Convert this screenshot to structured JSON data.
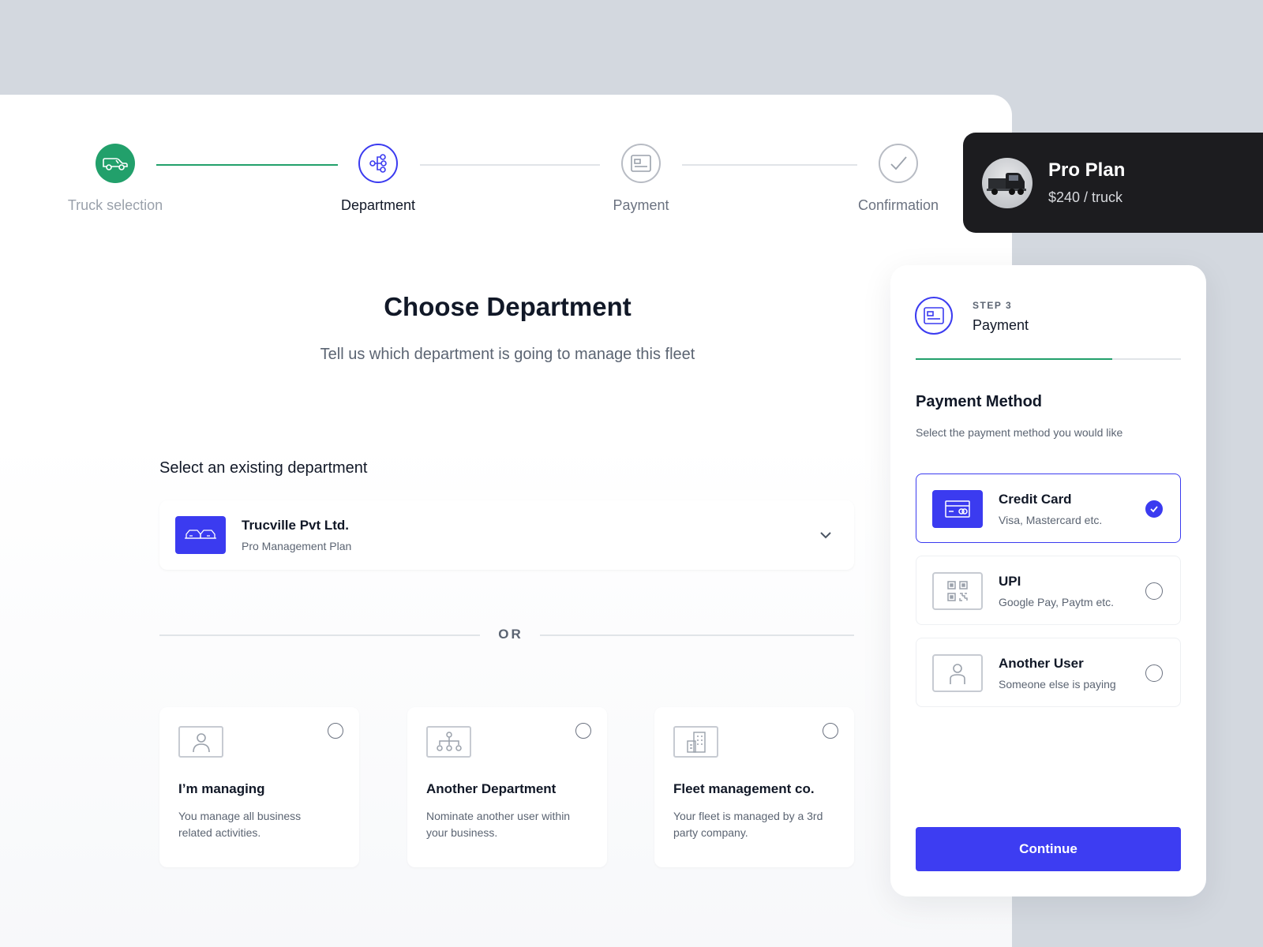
{
  "stepper": {
    "steps": [
      {
        "label": "Truck selection",
        "state": "done"
      },
      {
        "label": "Department",
        "state": "active"
      },
      {
        "label": "Payment",
        "state": "pending"
      },
      {
        "label": "Confirmation",
        "state": "pending"
      }
    ]
  },
  "main": {
    "title": "Choose Department",
    "subtitle": "Tell us which department is going to manage this fleet",
    "existing_label": "Select an existing department",
    "selected_department": {
      "name": "Trucville Pvt Ltd.",
      "plan": "Pro Management Plan"
    },
    "or_text": "OR",
    "options": [
      {
        "title": "I’m managing",
        "description": "You manage all business related activities."
      },
      {
        "title": "Another Department",
        "description": "Nominate another user within your business."
      },
      {
        "title": "Fleet management co.",
        "description": "Your fleet is managed by a 3rd party company."
      }
    ]
  },
  "plan": {
    "title": "Pro Plan",
    "price": "$240 / truck"
  },
  "payment": {
    "step_number": "STEP 3",
    "step_name": "Payment",
    "progress_fraction": 0.74,
    "title": "Payment Method",
    "subtitle": "Select the payment method you would like",
    "methods": [
      {
        "title": "Credit Card",
        "subtitle": "Visa, Mastercard etc.",
        "selected": true
      },
      {
        "title": "UPI",
        "subtitle": "Google Pay, Paytm etc.",
        "selected": false
      },
      {
        "title": "Another User",
        "subtitle": "Someone else is paying",
        "selected": false
      }
    ],
    "continue_label": "Continue"
  },
  "colors": {
    "accent": "#3b3bf0",
    "success": "#22a06b",
    "background": "#d3d8df"
  }
}
